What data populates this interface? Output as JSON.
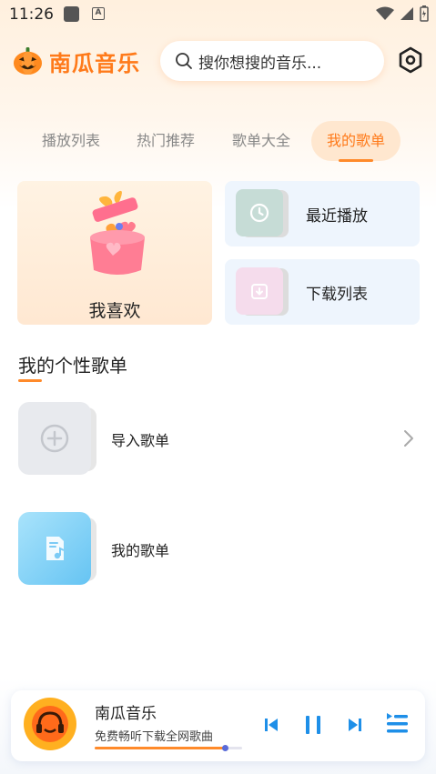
{
  "status_bar": {
    "time": "11:26"
  },
  "header": {
    "app_title": "南瓜音乐",
    "search_placeholder": "搜你想搜的音乐..."
  },
  "tabs": [
    {
      "label": "播放列表",
      "active": false
    },
    {
      "label": "热门推荐",
      "active": false
    },
    {
      "label": "歌单大全",
      "active": false
    },
    {
      "label": "我的歌单",
      "active": true
    }
  ],
  "cards": {
    "favorite": "我喜欢",
    "recent": "最近播放",
    "download": "下载列表"
  },
  "section": {
    "title": "我的个性歌单",
    "items": [
      {
        "label": "导入歌单"
      },
      {
        "label": "我的歌单"
      }
    ]
  },
  "player": {
    "title": "南瓜音乐",
    "subtitle": "免费畅听下载全网歌曲",
    "progress": 0.88
  },
  "colors": {
    "accent": "#ff7a1a",
    "tab_active_bg": "#ffe7cf",
    "player_controls": "#1e8fe8"
  },
  "icons": [
    "pumpkin-logo-icon",
    "search-icon",
    "settings-hexagon-icon",
    "clock-icon",
    "download-icon",
    "add-circle-icon",
    "chevron-right-icon",
    "playlist-note-icon",
    "prev-icon",
    "pause-icon",
    "next-icon",
    "playlist-menu-icon"
  ]
}
